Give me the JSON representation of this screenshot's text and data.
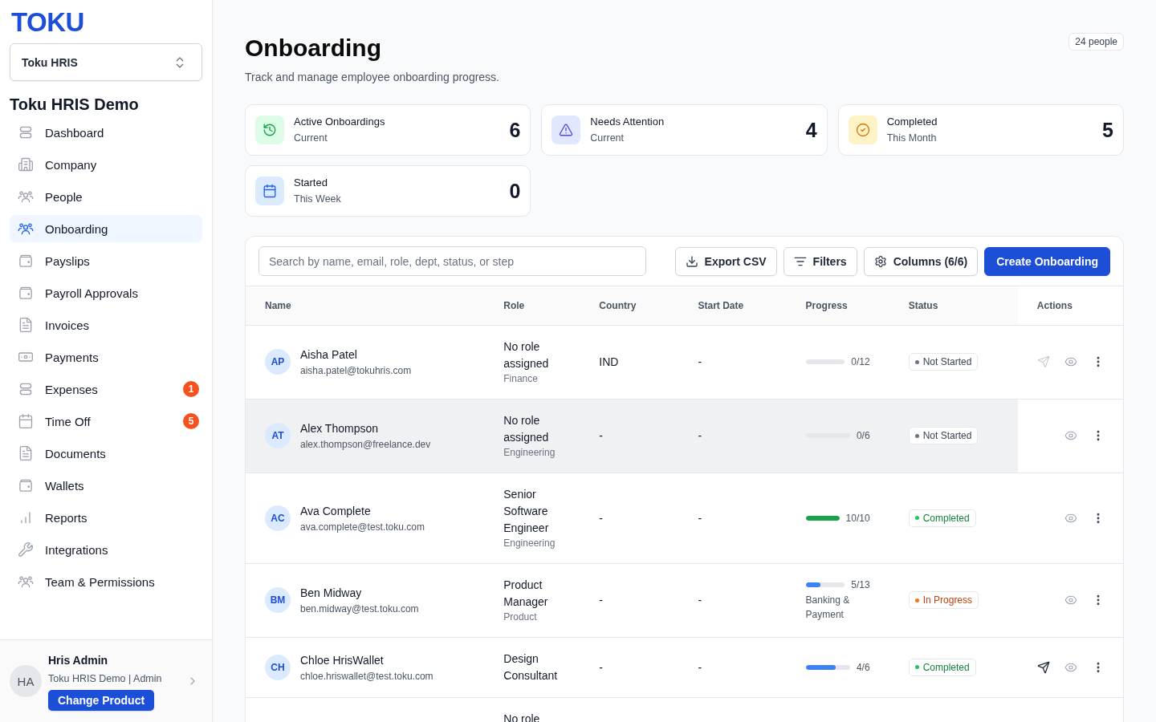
{
  "sidebar": {
    "logo": "TOKU",
    "product_select": {
      "value": "Toku HRIS"
    },
    "workspace": "Toku HRIS Demo",
    "items": [
      {
        "label": "Dashboard",
        "kind": "stack",
        "selected": false
      },
      {
        "label": "Company",
        "kind": "building",
        "selected": false
      },
      {
        "label": "People",
        "kind": "group",
        "selected": false
      },
      {
        "label": "Onboarding",
        "kind": "group",
        "selected": true
      },
      {
        "label": "Payslips",
        "kind": "wallet",
        "selected": false
      },
      {
        "label": "Payroll Approvals",
        "kind": "wallet",
        "selected": false
      },
      {
        "label": "Invoices",
        "kind": "document",
        "selected": false
      },
      {
        "label": "Payments",
        "kind": "banknote",
        "selected": false
      },
      {
        "label": "Expenses",
        "kind": "stack",
        "selected": false,
        "badge": "1"
      },
      {
        "label": "Time Off",
        "kind": "calendar",
        "selected": false,
        "badge": "5"
      },
      {
        "label": "Documents",
        "kind": "document",
        "selected": false
      },
      {
        "label": "Wallets",
        "kind": "wallet",
        "selected": false
      },
      {
        "label": "Reports",
        "kind": "chart",
        "selected": false
      },
      {
        "label": "Integrations",
        "kind": "wrench",
        "selected": false
      },
      {
        "label": "Team & Permissions",
        "kind": "group",
        "selected": false
      }
    ],
    "user": {
      "initials": "HA",
      "name": "Hris Admin",
      "subtitle": "Toku HRIS Demo | Admin",
      "button": "Change Product"
    }
  },
  "header": {
    "title": "Onboarding",
    "subtitle": "Track and manage employee onboarding progress.",
    "count_badge": "24 people"
  },
  "stats": [
    {
      "title": "Active Onboardings",
      "period": "Current",
      "count": "6",
      "kind": "active"
    },
    {
      "title": "Needs Attention",
      "period": "Current",
      "count": "4",
      "kind": "attention"
    },
    {
      "title": "Completed",
      "period": "This Month",
      "count": "5",
      "kind": "completed"
    },
    {
      "title": "Started",
      "period": "This Week",
      "count": "0",
      "kind": "started"
    }
  ],
  "toolbar": {
    "search": {
      "placeholder": "Search by name, email, role, dept, status, or step"
    },
    "buttons": [
      {
        "label": "Export CSV",
        "kind": "export"
      },
      {
        "label": "Filters",
        "kind": "filter"
      },
      {
        "label": "Columns (6/6)",
        "kind": "columns"
      },
      {
        "label": "Create Onboarding",
        "kind": "primary"
      }
    ]
  },
  "table": {
    "columns": [
      "Name",
      "Role",
      "Country",
      "Start Date",
      "Progress",
      "Status",
      "Actions"
    ],
    "rows": [
      {
        "initials": "AP",
        "name": "Aisha Patel",
        "email": "aisha.patel@tokuhris.com",
        "role": "No role assigned",
        "department": "Finance",
        "country": "IND",
        "start_date": "-",
        "progress": {
          "count": "0/12",
          "level": 0
        },
        "status": {
          "label": "Not Started",
          "kind": "not_started"
        },
        "send_action": {
          "disabled": true
        },
        "hovered": false
      },
      {
        "initials": "AT",
        "name": "Alex Thompson",
        "email": "alex.thompson@freelance.dev",
        "role": "No role assigned",
        "department": "Engineering",
        "country": "-",
        "start_date": "-",
        "progress": {
          "count": "0/6",
          "level": 0
        },
        "status": {
          "label": "Not Started",
          "kind": "not_started"
        },
        "hovered": true
      },
      {
        "initials": "AC",
        "name": "Ava Complete",
        "email": "ava.complete@test.toku.com",
        "role": "Senior Software Engineer",
        "department": "Engineering",
        "country": "-",
        "start_date": "-",
        "progress": {
          "count": "10/10",
          "level": 1
        },
        "status": {
          "label": "Completed",
          "kind": "completed"
        },
        "hovered": false
      },
      {
        "initials": "BM",
        "name": "Ben Midway",
        "email": "ben.midway@test.toku.com",
        "role": "Product Manager",
        "department": "Product",
        "country": "-",
        "start_date": "-",
        "progress": {
          "count": "5/13",
          "level": 0.38,
          "step": "Banking & Payment"
        },
        "status": {
          "label": "In Progress",
          "kind": "in_progress"
        },
        "hovered": false
      },
      {
        "initials": "CH",
        "name": "Chloe HrisWallet",
        "email": "chloe.hriswallet@test.toku.com",
        "role": "Design Consultant",
        "country": "-",
        "start_date": "-",
        "progress": {
          "count": "4/6",
          "level": 0.67
        },
        "status": {
          "label": "Completed",
          "kind": "completed"
        },
        "send_action": {
          "disabled": false
        },
        "hovered": false
      },
      {
        "role": "No role",
        "hovered": false
      }
    ]
  }
}
